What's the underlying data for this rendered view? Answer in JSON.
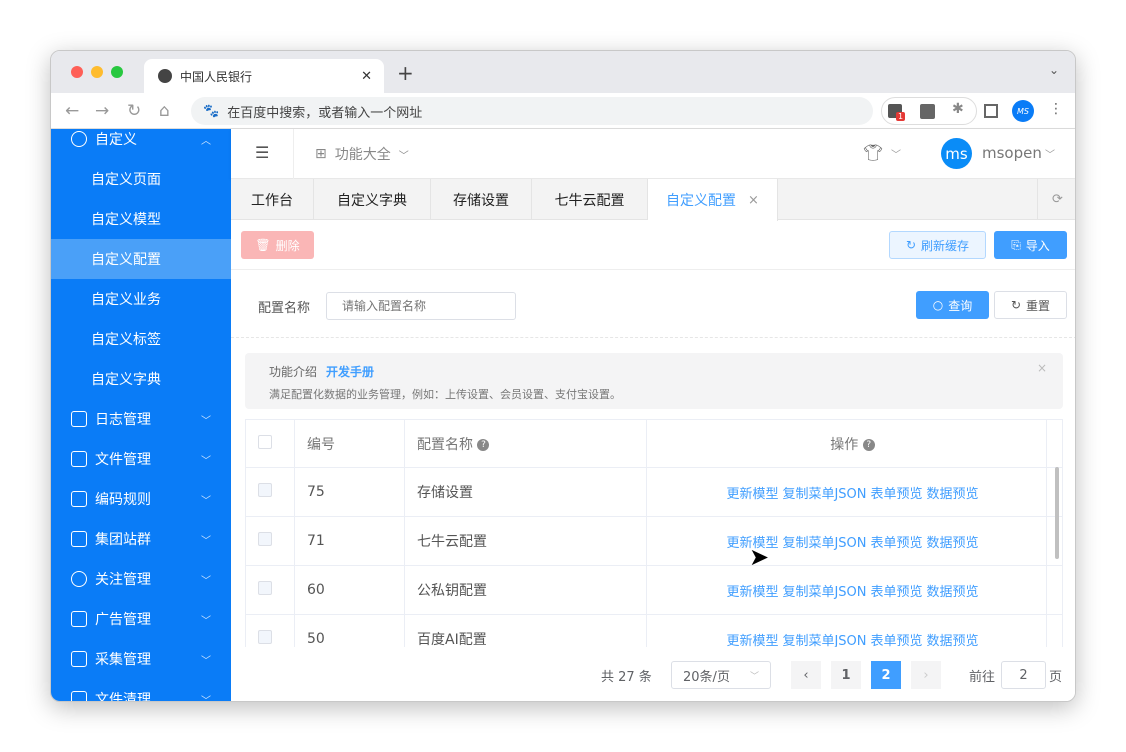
{
  "browser": {
    "tab_title": "中国人民银行",
    "address_placeholder": "在百度中搜索，或者输入一个网址",
    "ext_badge": "1",
    "profile": "MS"
  },
  "sidebar": {
    "section": "自定义",
    "sub_items": [
      "自定义页面",
      "自定义模型",
      "自定义配置",
      "自定义业务",
      "自定义标签",
      "自定义字典"
    ],
    "active": "自定义配置",
    "groups": [
      "日志管理",
      "文件管理",
      "编码规则",
      "集团站群",
      "关注管理",
      "广告管理",
      "采集管理",
      "文件清理"
    ]
  },
  "header": {
    "menu_label": "功能大全",
    "user_avatar": "ms",
    "user_name": "msopen"
  },
  "tabs": [
    {
      "label": "工作台"
    },
    {
      "label": "自定义字典"
    },
    {
      "label": "存储设置"
    },
    {
      "label": "七牛云配置"
    },
    {
      "label": "自定义配置",
      "close": "×"
    }
  ],
  "toolbar": {
    "delete": "删除",
    "refresh_cache": "刷新缓存",
    "import": "导入"
  },
  "search": {
    "label": "配置名称",
    "placeholder": "请输入配置名称",
    "query": "查询",
    "reset": "重置"
  },
  "notice": {
    "title": "功能介绍",
    "link": "开发手册",
    "text": "满足配置化数据的业务管理，例如：上传设置、会员设置、支付宝设置。",
    "close": "×"
  },
  "table": {
    "headers": [
      "编号",
      "配置名称",
      "操作"
    ],
    "help": "?",
    "actions": [
      "更新模型",
      "复制菜单JSON",
      "表单预览",
      "数据预览"
    ],
    "rows": [
      {
        "id": "75",
        "name": "存储设置"
      },
      {
        "id": "71",
        "name": "七牛云配置"
      },
      {
        "id": "60",
        "name": "公私钥配置"
      },
      {
        "id": "50",
        "name": "百度AI配置"
      }
    ]
  },
  "pagination": {
    "total": "共 27 条",
    "page_size": "20条/页",
    "pages": [
      "1",
      "2"
    ],
    "current": "2",
    "goto_label": "前往",
    "goto_value": "2",
    "page_suffix": "页"
  }
}
